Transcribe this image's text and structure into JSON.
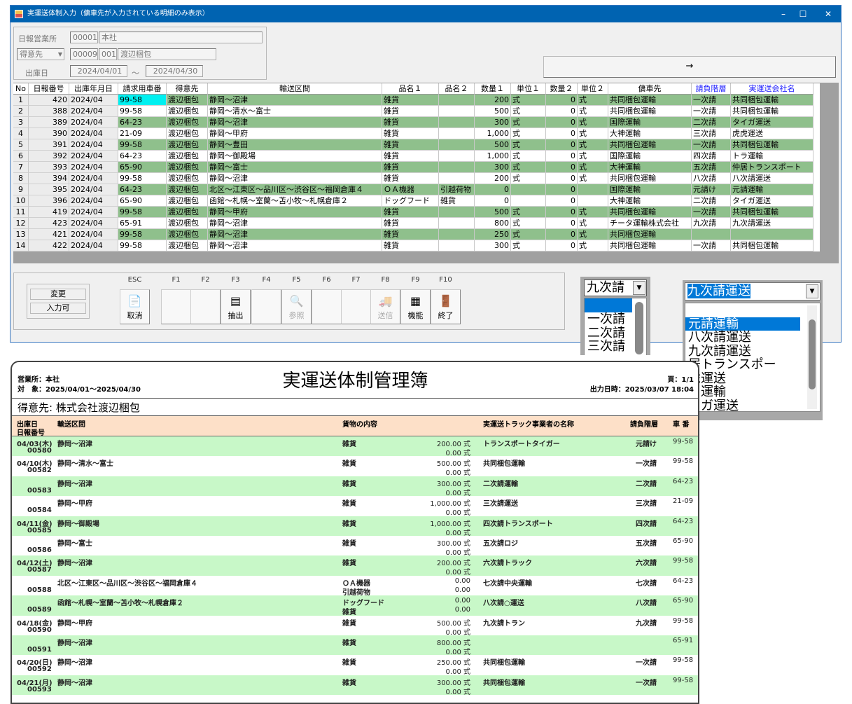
{
  "window": {
    "title": "実運送体制入力（傭車先が入力されている明細のみ表示）",
    "minimize": "–",
    "maximize": "☐",
    "close": "✕"
  },
  "filters": {
    "office_label": "日報営業所",
    "office_code": "00001",
    "office_name": "本社",
    "customer_select": "得意先",
    "customer_code": "00009",
    "customer_sub": "001",
    "customer_name": "渡辺梱包",
    "date_label": "出庫日",
    "date_from": "2024/04/01",
    "date_sep": "～",
    "date_to": "2024/04/30"
  },
  "arrow_button": "→",
  "grid": {
    "headers": [
      "No",
      "日報番号",
      "出庫年月日",
      "請求用車番",
      "得意先",
      "輸送区間",
      "品名１",
      "品名２",
      "数量１",
      "単位１",
      "数量２",
      "単位２",
      "傭車先",
      "請負階層",
      "実運送会社名"
    ],
    "rows": [
      [
        "1",
        "420",
        "2024/04",
        "99-58",
        "渡辺梱包",
        "静岡～沼津",
        "雑貨",
        "",
        "200",
        "式",
        "0",
        "式",
        "共同梱包運輸",
        "一次請",
        "共同梱包運輸"
      ],
      [
        "2",
        "388",
        "2024/04",
        "99-58",
        "渡辺梱包",
        "静岡～清水～富士",
        "雑貨",
        "",
        "500",
        "式",
        "0",
        "式",
        "共同梱包運輸",
        "一次請",
        "共同梱包運輸"
      ],
      [
        "3",
        "389",
        "2024/04",
        "64-23",
        "渡辺梱包",
        "静岡～沼津",
        "雑貨",
        "",
        "300",
        "式",
        "0",
        "式",
        "国際運輸",
        "二次請",
        "タイガ運送"
      ],
      [
        "4",
        "390",
        "2024/04",
        "21-09",
        "渡辺梱包",
        "静岡～甲府",
        "雑貨",
        "",
        "1,000",
        "式",
        "0",
        "式",
        "大神運輸",
        "三次請",
        "虎虎運送"
      ],
      [
        "5",
        "391",
        "2024/04",
        "99-58",
        "渡辺梱包",
        "静岡～豊田",
        "雑貨",
        "",
        "500",
        "式",
        "0",
        "式",
        "共同梱包運輸",
        "一次請",
        "共同梱包運輸"
      ],
      [
        "6",
        "392",
        "2024/04",
        "64-23",
        "渡辺梱包",
        "静岡～御殿場",
        "雑貨",
        "",
        "1,000",
        "式",
        "0",
        "式",
        "国際運輸",
        "四次請",
        "トラ運輸"
      ],
      [
        "7",
        "393",
        "2024/04",
        "65-90",
        "渡辺梱包",
        "静岡～富士",
        "雑貨",
        "",
        "300",
        "式",
        "0",
        "式",
        "大神運輸",
        "五次請",
        "仲居トランスポート"
      ],
      [
        "8",
        "394",
        "2024/04",
        "99-58",
        "渡辺梱包",
        "静岡～沼津",
        "雑貨",
        "",
        "200",
        "式",
        "0",
        "式",
        "共同梱包運輸",
        "八次請",
        "八次請運送"
      ],
      [
        "9",
        "395",
        "2024/04",
        "64-23",
        "渡辺梱包",
        "北区～江東区～品川区～渋谷区～福岡倉庫４",
        "ＯＡ機器",
        "引越荷物",
        "0",
        "",
        "0",
        "",
        "国際運輸",
        "元請け",
        "元請運輸"
      ],
      [
        "10",
        "396",
        "2024/04",
        "65-90",
        "渡辺梱包",
        "函館～札幌～室蘭～苫小牧～札幌倉庫２",
        "ドッグフード",
        "雑貨",
        "0",
        "",
        "0",
        "",
        "大神運輸",
        "二次請",
        "タイガ運送"
      ],
      [
        "11",
        "419",
        "2024/04",
        "99-58",
        "渡辺梱包",
        "静岡～甲府",
        "雑貨",
        "",
        "500",
        "式",
        "0",
        "式",
        "共同梱包運輸",
        "一次請",
        "共同梱包運輸"
      ],
      [
        "12",
        "423",
        "2024/04",
        "65-91",
        "渡辺梱包",
        "静岡～沼津",
        "雑貨",
        "",
        "800",
        "式",
        "0",
        "式",
        "チータ運輸株式会社",
        "九次請",
        "九次請運送"
      ],
      [
        "13",
        "421",
        "2024/04",
        "99-58",
        "渡辺梱包",
        "静岡～沼津",
        "雑貨",
        "",
        "250",
        "式",
        "0",
        "式",
        "共同梱包運輸",
        "",
        ""
      ],
      [
        "14",
        "422",
        "2024/04",
        "99-58",
        "渡辺梱包",
        "静岡～沼津",
        "雑貨",
        "",
        "300",
        "式",
        "0",
        "式",
        "共同梱包運輸",
        "一次請",
        "共同梱包運輸"
      ]
    ]
  },
  "status": {
    "mode": "変更",
    "input": "入力可"
  },
  "fkeys": [
    {
      "key": "ESC",
      "label": "取消",
      "icon": "cancel-icon",
      "enabled": true
    },
    {
      "key": "F1",
      "label": ""
    },
    {
      "key": "F2",
      "label": ""
    },
    {
      "key": "F3",
      "label": "抽出",
      "icon": "extract-icon",
      "enabled": true
    },
    {
      "key": "F4",
      "label": ""
    },
    {
      "key": "F5",
      "label": "参照",
      "icon": "search-icon",
      "enabled": false
    },
    {
      "key": "F6",
      "label": ""
    },
    {
      "key": "F7",
      "label": ""
    },
    {
      "key": "F8",
      "label": "送信",
      "icon": "truck-icon",
      "enabled": false
    },
    {
      "key": "F9",
      "label": "機能",
      "icon": "table-icon",
      "enabled": true
    },
    {
      "key": "F10",
      "label": "終了",
      "icon": "exit-icon",
      "enabled": true
    }
  ],
  "tier_dropdown": {
    "value": "九次請",
    "options": [
      "",
      "一次請",
      "二次請",
      "三次請"
    ]
  },
  "company_dropdown": {
    "value": "九次請運送",
    "options": [
      "",
      "元請運輸",
      "八次請運送",
      "九次請運送",
      "仲居トランスポート",
      "虎虎運送",
      "トラ運輸",
      "タイガ運送"
    ],
    "visible_options": [
      "",
      "元請運輸",
      "八次請運送",
      "九次請運送",
      "居トランスポー",
      "虎運送",
      "ラ運輸",
      "イガ運送"
    ],
    "selected_index": 1
  },
  "report": {
    "title": "実運送体制管理簿",
    "office": "営業所：本社",
    "target": "対　象：2025/04/01～2025/04/30",
    "page": "頁：1/1",
    "printed": "出力日時：2025/03/07 18:04",
    "customer": "得意先:  株式会社渡辺梱包",
    "headers": {
      "date": "出庫日",
      "number": "日報番号",
      "route": "輸送区間",
      "goods": "貨物の内容",
      "company": "実運送トラック事業者の名称",
      "tier": "請負階層",
      "car": "車 番"
    },
    "rows": [
      {
        "date": "04/03(木)",
        "no": "00580",
        "route": "静岡～沼津",
        "g1": "雑貨",
        "g2": "",
        "q1": "200.00 式",
        "q2": "0.00 式",
        "company": "トランスポートタイガー",
        "tier": "元請け",
        "car": "99-58"
      },
      {
        "date": "04/10(木)",
        "no": "00582",
        "route": "静岡～清水～富士",
        "g1": "雑貨",
        "g2": "",
        "q1": "500.00 式",
        "q2": "0.00 式",
        "company": "共同梱包運輸",
        "tier": "一次請",
        "car": "99-58"
      },
      {
        "date": "",
        "no": "00583",
        "route": "静岡～沼津",
        "g1": "雑貨",
        "g2": "",
        "q1": "300.00 式",
        "q2": "0.00 式",
        "company": "二次請運輸",
        "tier": "二次請",
        "car": "64-23"
      },
      {
        "date": "",
        "no": "00584",
        "route": "静岡～甲府",
        "g1": "雑貨",
        "g2": "",
        "q1": "1,000.00 式",
        "q2": "0.00 式",
        "company": "三次請運送",
        "tier": "三次請",
        "car": "21-09"
      },
      {
        "date": "04/11(金)",
        "no": "00585",
        "route": "静岡～御殿場",
        "g1": "雑貨",
        "g2": "",
        "q1": "1,000.00 式",
        "q2": "0.00 式",
        "company": "四次請トランスポート",
        "tier": "四次請",
        "car": "64-23"
      },
      {
        "date": "",
        "no": "00586",
        "route": "静岡～富士",
        "g1": "雑貨",
        "g2": "",
        "q1": "300.00 式",
        "q2": "0.00 式",
        "company": "五次請ロジ",
        "tier": "五次請",
        "car": "65-90"
      },
      {
        "date": "04/12(土)",
        "no": "00587",
        "route": "静岡～沼津",
        "g1": "雑貨",
        "g2": "",
        "q1": "200.00 式",
        "q2": "0.00 式",
        "company": "六次請トラック",
        "tier": "六次請",
        "car": "99-58"
      },
      {
        "date": "",
        "no": "00588",
        "route": "北区～江東区～品川区～渋谷区～福岡倉庫４",
        "g1": "ＯＡ機器",
        "g2": "引越荷物",
        "q1": "0.00",
        "q2": "0.00",
        "company": "七次請中央運輸",
        "tier": "七次請",
        "car": "64-23"
      },
      {
        "date": "",
        "no": "00589",
        "route": "函館～札幌～室蘭～苫小牧～札幌倉庫２",
        "g1": "ドッグフード",
        "g2": "雑貨",
        "q1": "0.00",
        "q2": "0.00",
        "company": "八次請○運送",
        "tier": "八次請",
        "car": "65-90"
      },
      {
        "date": "04/18(金)",
        "no": "00590",
        "route": "静岡～甲府",
        "g1": "雑貨",
        "g2": "",
        "q1": "500.00 式",
        "q2": "0.00 式",
        "company": "九次請トラン",
        "tier": "九次請",
        "car": "99-58"
      },
      {
        "date": "",
        "no": "00591",
        "route": "静岡～沼津",
        "g1": "雑貨",
        "g2": "",
        "q1": "800.00 式",
        "q2": "0.00 式",
        "company": "",
        "tier": "",
        "car": "65-91"
      },
      {
        "date": "04/20(日)",
        "no": "00592",
        "route": "静岡～沼津",
        "g1": "雑貨",
        "g2": "",
        "q1": "250.00 式",
        "q2": "0.00 式",
        "company": "共同梱包運輸",
        "tier": "一次請",
        "car": "99-58"
      },
      {
        "date": "04/21(月)",
        "no": "00593",
        "route": "静岡～沼津",
        "g1": "雑貨",
        "g2": "",
        "q1": "300.00 式",
        "q2": "0.00 式",
        "company": "共同梱包運輸",
        "tier": "一次請",
        "car": "99-58"
      }
    ]
  },
  "colors": {
    "title_bar": "#0063b1",
    "row_green": "#8fc08c",
    "highlight_cell": "#00f0f0",
    "header_blue": "#1a1aff",
    "report_header": "#fde0c8",
    "report_green": "#c8f8c8",
    "selection": "#0078d7"
  }
}
